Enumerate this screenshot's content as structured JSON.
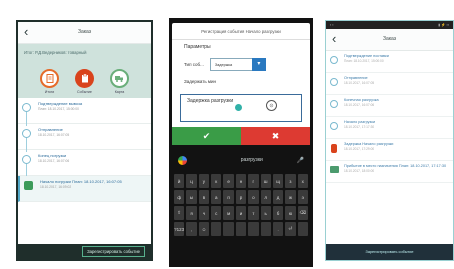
{
  "phone1": {
    "title": "Заказ",
    "header_text": "Итог: Р.Д.Ведерников: товарный",
    "actions": [
      {
        "label": "Итоги",
        "icon": "document-icon"
      },
      {
        "label": "Событие",
        "icon": "clipboard-icon"
      },
      {
        "label": "Карта",
        "icon": "truck-icon"
      }
    ],
    "events": [
      {
        "title": "Подтверждение вывоза",
        "date": "План: 18.10.2017, 15:00:00"
      },
      {
        "title": "Отправление",
        "date": "18.10.2017, 16:07:05"
      },
      {
        "title": "Конец погрузки",
        "date": "18.10.2017, 16:07:06"
      },
      {
        "title": "Начало погрузки План: 18.10.2017, 16:07:05",
        "date": "18.10.2017, 16:09:02"
      }
    ],
    "bottom_button": "Зарегистрировать событие"
  },
  "phone2": {
    "dialog_title": "Регистрация события Начало разгрузки",
    "params_label": "Параметры",
    "type_label": "Тип соб...",
    "type_value": "Задержка",
    "delay_label": "Задержать мин",
    "text_value": "Задержка разгрузки",
    "ok_symbol": "✔",
    "cancel_symbol": "✖",
    "suggestion": "разгрузки",
    "keys": [
      "й",
      "ц",
      "у",
      "к",
      "е",
      "н",
      "г",
      "ш",
      "щ",
      "з",
      "х",
      "ф",
      "ы",
      "в",
      "а",
      "п",
      "р",
      "о",
      "л",
      "д",
      "ж",
      "э",
      "⇧",
      "я",
      "ч",
      "с",
      "м",
      "и",
      "т",
      "ь",
      "б",
      "ю",
      "⌫",
      "?123",
      ",",
      "☺",
      "",
      "",
      "",
      "",
      "",
      ".",
      "⏎",
      ""
    ],
    "space_label": "Русский"
  },
  "phone3": {
    "title": "Заказ",
    "events": [
      {
        "title": "Подтверждение поставки",
        "date": "План: 18.10.2017, 15:00:00",
        "kind": "circle"
      },
      {
        "title": "Отправление",
        "date": "18.10.2017, 16:07:05",
        "kind": "circle"
      },
      {
        "title": "Конечная разгрузка",
        "date": "18.10.2017, 16:07:06",
        "kind": "circle"
      },
      {
        "title": "Начало разгрузки",
        "date": "18.10.2017, 17:17:30",
        "kind": "circle"
      },
      {
        "title": "Задержка Начало разгрузки",
        "date": "18.10.2017, 17:29:00",
        "kind": "red"
      },
      {
        "title": "Прибытие в место назначения План: 18.10.2017, 17:17:30",
        "date": "18.10.2017, 18:00:00",
        "kind": "green"
      }
    ],
    "bottom_button": "Зарегистрировать событие"
  }
}
